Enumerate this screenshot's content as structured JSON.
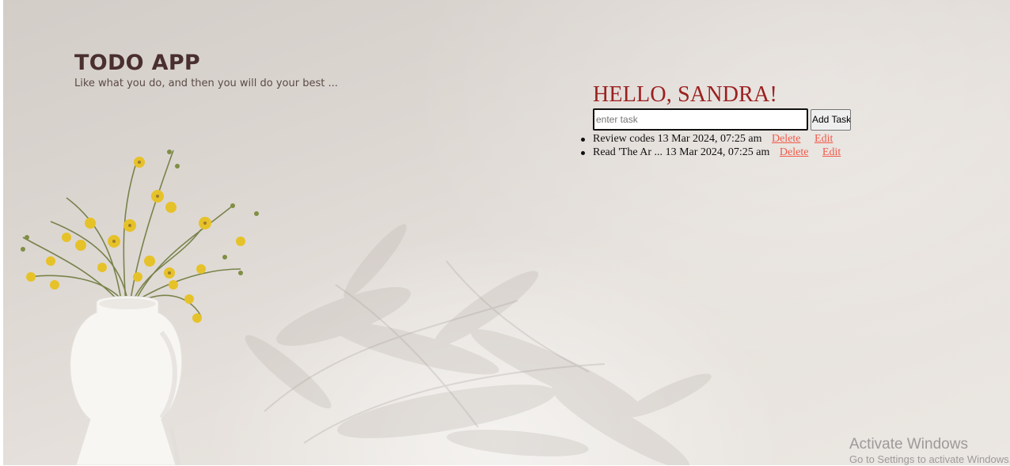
{
  "app": {
    "title": "TODO APP",
    "subtitle": "Like what you do, and then you will do your best ..."
  },
  "panel": {
    "greeting": "HELLO, SANDRA!",
    "input_placeholder": "enter task",
    "input_value": "",
    "add_button_label": "Add Task"
  },
  "tasks": [
    {
      "text": "Review codes",
      "timestamp": "13 Mar 2024, 07:25 am",
      "delete_label": "Delete",
      "edit_label": "Edit"
    },
    {
      "text": "Read 'The Ar ...",
      "timestamp": "13 Mar 2024, 07:25 am",
      "delete_label": "Delete",
      "edit_label": "Edit"
    }
  ],
  "watermark": {
    "title": "Activate Windows",
    "subtitle": "Go to Settings to activate Windows."
  },
  "colors": {
    "title": "#4a2f2f",
    "greeting": "#9b2020",
    "link": "#f05a4a",
    "background": "#ddd7d2"
  },
  "background_image": {
    "icon": "vase-with-yellow-flowers-image"
  }
}
